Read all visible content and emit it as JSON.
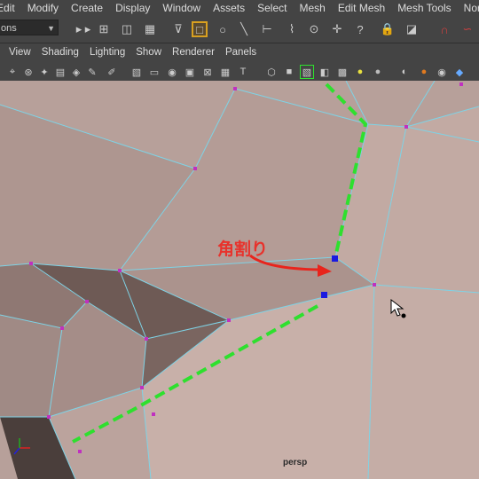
{
  "menubar": {
    "items": [
      "Edit",
      "Modify",
      "Create",
      "Display",
      "Window",
      "Assets",
      "Select",
      "Mesh",
      "Edit Mesh",
      "Mesh Tools",
      "Normals"
    ]
  },
  "statusline": {
    "mode_value": "ons",
    "icons": [
      "component-mask-icon",
      "select-hierarchy-icon",
      "select-object-icon",
      "select-component-icon",
      "selection-mask-icon",
      "vertex-mask-icon",
      "edge-mask-icon",
      "face-mask-icon",
      "uv-mask-icon",
      "pivot-mask-icon",
      "plus-mask-icon",
      "help-icon",
      "lock-icon",
      "highlight-icon",
      "magnet-icon",
      "snap-curve-icon"
    ]
  },
  "panel": {
    "menus": [
      "View",
      "Shading",
      "Lighting",
      "Show",
      "Renderer",
      "Panels"
    ]
  },
  "viewport": {
    "annotation": "角割り",
    "camera_label": "persp",
    "colors": {
      "surface": "#b7a09a",
      "wire": "#7ed3e6",
      "vertex": "#c030c0",
      "guide": "#2ee02e",
      "arrow": "#e8241c",
      "handle": "#1a1ae0"
    }
  }
}
